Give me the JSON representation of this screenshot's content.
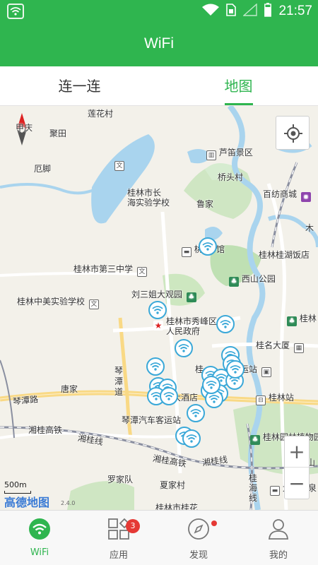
{
  "status_bar": {
    "time": "21:57",
    "icons": [
      "wifi-app-icon",
      "wifi-signal-icon",
      "sim-card-icon",
      "cell-signal-icon",
      "battery-icon"
    ]
  },
  "header": {
    "title": "WiFi"
  },
  "tabs": [
    {
      "label": "连一连",
      "active": false
    },
    {
      "label": "地图",
      "active": true
    }
  ],
  "map": {
    "labels": {
      "lianhuacun": "莲花村",
      "jutian": "聚田",
      "ejiao": "厄脚",
      "tianqing": "甲庆",
      "haishi": "桂林市长\n海实验学校",
      "lumiao": "芦笛景区",
      "qiaotoucun": "桥头村",
      "baifang": "百纺商城",
      "lujia": "鲁家",
      "mu": "木",
      "taohua": "桃",
      "guan": "馆",
      "guilinhu": "桂林桂湖饭店",
      "sanzhong": "桂林市第三中学",
      "xishan": "西山公园",
      "zhongmei": "桂林中美实验学校",
      "liusanjie": "刘三姐大观园",
      "xiufeng": "桂林市秀峰区\n人民政府",
      "guilin": "桂林",
      "guiming": "桂名大厦",
      "yunzhan": "运站",
      "gui": "桂",
      "tangjia": "唐家",
      "tandao": "琴\n潭\n道",
      "dajiudian": "大酒店",
      "guilinzhan": "桂林站",
      "tanlu": "琴潭路",
      "qichezhan": "琴潭汽车客运站",
      "xianggui_gaotie": "湘桂高铁",
      "xiangguixian": "湘桂线",
      "xianggui_gaotie2": "湘桂高铁",
      "xiangguixian2": "湘桂线",
      "botanical": "桂林园林植物园",
      "nanxi": "南溪山",
      "dazheng": "大正温泉",
      "luojiadui": "罗家队",
      "xiajiacun": "夏家村",
      "bottomcut": "桂林市桂花",
      "guihai": "桂\n海\n线"
    },
    "scale_text": "500m",
    "logo_text": "高德地图",
    "logo_version": "2.4.0",
    "zoom_in": "+",
    "zoom_out": "−",
    "wifi_hotspots": 22
  },
  "bottom_nav": [
    {
      "label": "WiFi",
      "active": true,
      "icon": "wifi-nav-icon"
    },
    {
      "label": "应用",
      "active": false,
      "icon": "apps-grid-icon",
      "badge": "3"
    },
    {
      "label": "发现",
      "active": false,
      "icon": "compass-discover-icon",
      "dot": true
    },
    {
      "label": "我的",
      "active": false,
      "icon": "person-icon"
    }
  ],
  "colors": {
    "brand": "#2fb54f",
    "wifi_pin": "#3aa8d8",
    "badge": "#e53935"
  }
}
